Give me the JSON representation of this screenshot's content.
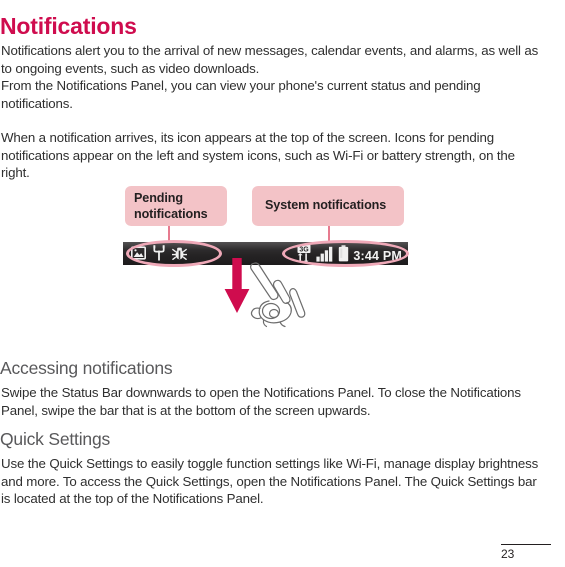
{
  "document": {
    "chapter_title": "Notifications",
    "page_number": "23"
  },
  "intro_paragraphs": {
    "p1": "Notifications alert you to the arrival of new messages, calendar events, and alarms, as well as to ongoing events, such as video downloads.\nFrom the Notifications Panel, you can view your phone's current status and pending notifications.",
    "p2": "When a notification arrives, its icon appears at the top of the screen. Icons for pending notifications appear on the left and system icons, such as Wi-Fi or battery strength, on the right."
  },
  "figure": {
    "callouts": [
      {
        "id": "pending",
        "label": "Pending\nnotifications"
      },
      {
        "id": "system",
        "label": "System notifications"
      }
    ],
    "status_bar": {
      "time": "3:44 PM",
      "network_label": "3G",
      "pending_icons": [
        "image-icon",
        "usb-icon",
        "bug-icon"
      ],
      "system_icons": [
        "network-3g-icon",
        "signal-bars-icon",
        "battery-icon",
        "clock-label"
      ]
    },
    "gesture": {
      "arrow": "swipe-down-arrow",
      "hand": "hand-swipe-icon"
    },
    "colors": {
      "callout_background": "#f3c3c7",
      "accent": "#cf0c4e",
      "highlight_outline": "#efa9b8",
      "status_bar_background": "#2c2a2b"
    }
  },
  "sections": [
    {
      "heading": "Accessing notifications",
      "body": "Swipe the Status Bar downwards to open the Notifications Panel. To close the Notifications Panel, swipe the bar that is at the bottom of the screen upwards."
    },
    {
      "heading": "Quick Settings",
      "body": "Use the Quick Settings to easily toggle function settings like Wi-Fi, manage display brightness and more. To access the Quick Settings, open the Notifications Panel. The Quick Settings bar is located at the top of the Notifications Panel."
    }
  ]
}
